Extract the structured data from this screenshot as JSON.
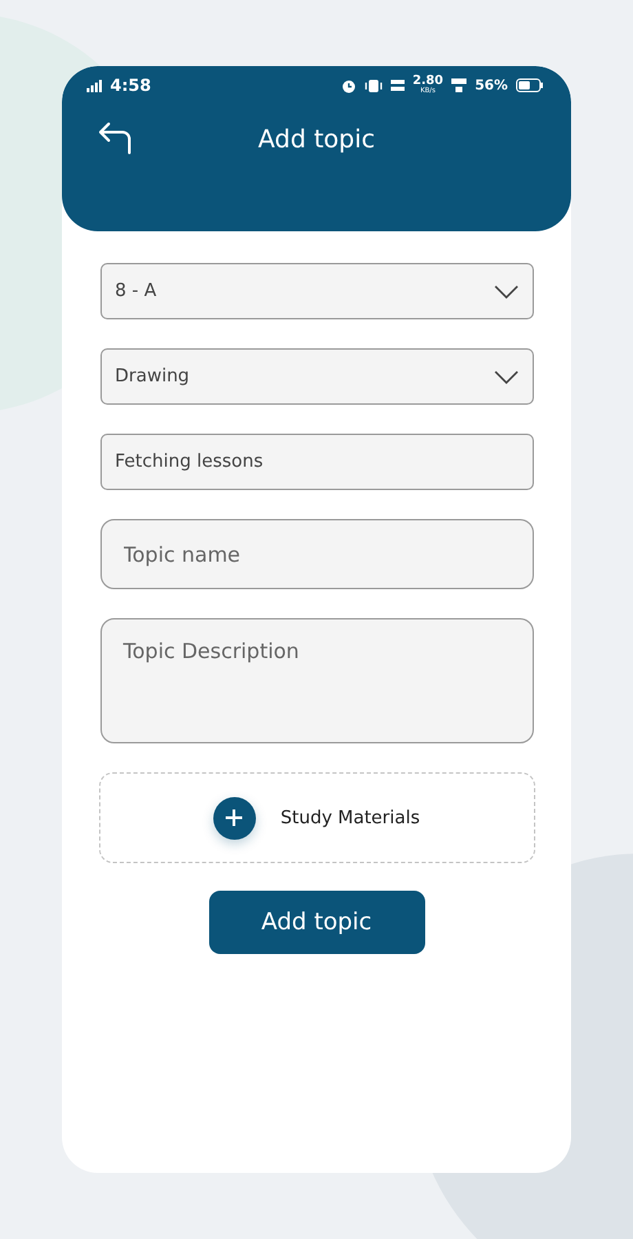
{
  "status_bar": {
    "time": "4:58",
    "speed": "2.80",
    "speed_unit": "KB/s",
    "battery": "56%"
  },
  "header": {
    "title": "Add topic"
  },
  "fields": [
    {
      "kind": "select",
      "value": "8 - A"
    },
    {
      "kind": "select",
      "value": "Drawing"
    },
    {
      "kind": "text",
      "value": "Fetching lessons"
    },
    {
      "kind": "input",
      "placeholder": "Topic name"
    },
    {
      "kind": "textarea",
      "placeholder": "Topic Description"
    }
  ],
  "attachment": {
    "label": "Study Materials"
  },
  "submit": {
    "label": "Add topic"
  }
}
